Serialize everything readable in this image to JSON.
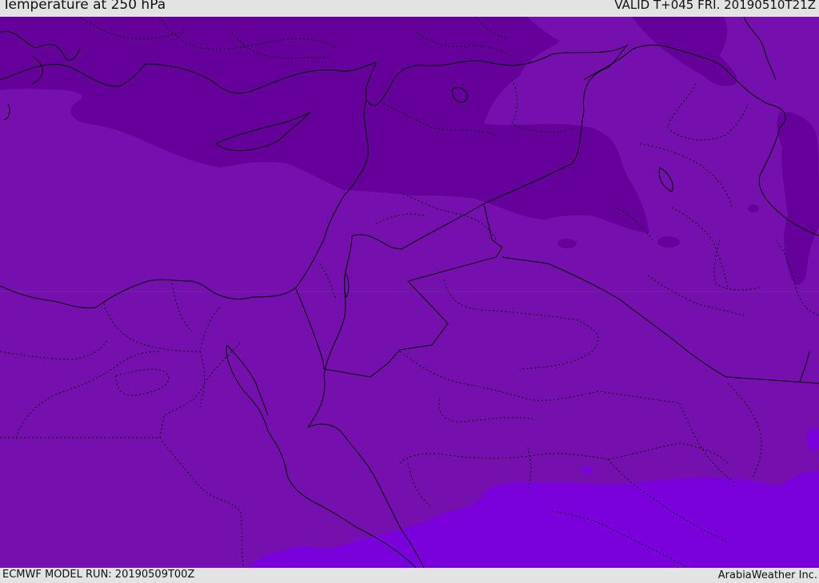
{
  "header": {
    "title": "Temperature at 250 hPa",
    "valid_time": "VALID T+045 FRI. 20190510T21Z"
  },
  "footer": {
    "model_run": "ECMWF MODEL RUN: 20190509T00Z",
    "credit": "ArabiaWeather Inc."
  },
  "map": {
    "variable": "temperature",
    "level": "250 hPa",
    "colors": {
      "coldest": "#65019a",
      "mid": "#7510ae",
      "warm": "#7a00dc",
      "border": "#000000"
    }
  }
}
